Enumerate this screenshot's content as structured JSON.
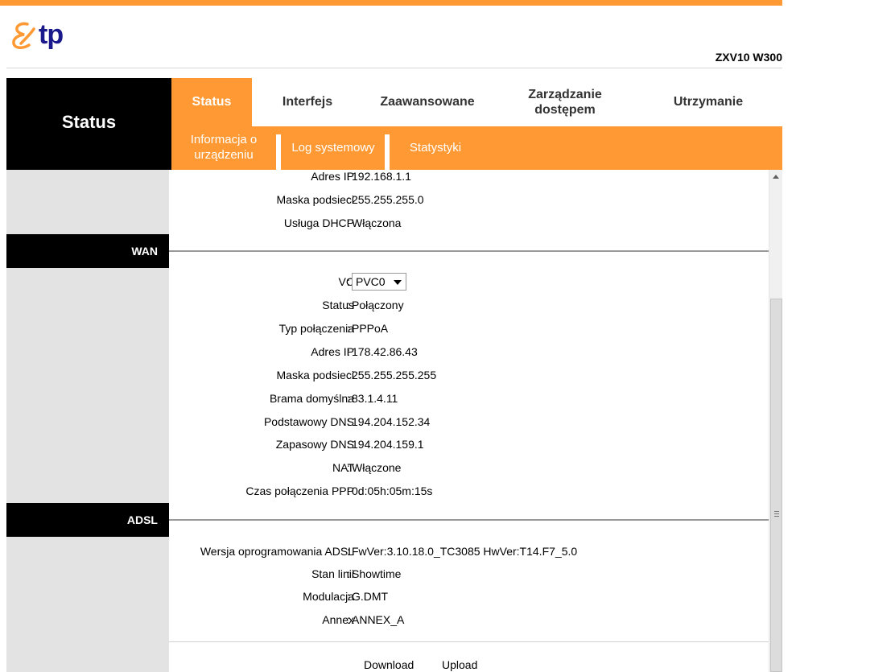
{
  "brand": {
    "logo_text": "tp",
    "model": "ZXV10 W300"
  },
  "colors": {
    "accent": "#ff9933",
    "section": "#000000",
    "left_panel": "#e3e3e3"
  },
  "left_title": "Status",
  "menu": {
    "status": "Status",
    "interfejs": "Interfejs",
    "zaawansowane": "Zaawansowane",
    "zarzadzanie": "Zarządzanie dostępem",
    "utrzymanie": "Utrzymanie"
  },
  "submenu": {
    "informacja": "Informacja o urządzeniu",
    "log": "Log systemowy",
    "statystyki": "Statystyki"
  },
  "lan": {
    "ip_label": "Adres IP",
    "ip_value": "192.168.1.1",
    "mask_label": "Maska podsieci",
    "mask_value": "255.255.255.0",
    "dhcp_label": "Usługa DHCP",
    "dhcp_value": "Włączona"
  },
  "wan": {
    "title": "WAN",
    "vc_label": "VC",
    "vc_selected": "PVC0",
    "status_label": "Status",
    "status_value": "Połączony",
    "type_label": "Typ połączenia",
    "type_value": "PPPoA",
    "ip_label": "Adres IP",
    "ip_value": "178.42.86.43",
    "mask_label": "Maska podsieci",
    "mask_value": "255.255.255.255",
    "gateway_label": "Brama domyślna",
    "gateway_value": "83.1.4.11",
    "dns1_label": "Podstawowy DNS",
    "dns1_value": "194.204.152.34",
    "dns2_label": "Zapasowy DNS",
    "dns2_value": "194.204.159.1",
    "nat_label": "NAT",
    "nat_value": "Włączone",
    "ppp_time_label": "Czas połączenia PPP",
    "ppp_time_value": "0d:05h:05m:15s"
  },
  "adsl": {
    "title": "ADSL",
    "fw_label": "Wersja oprogramowania ADSL",
    "fw_value": "FwVer:3.10.18.0_TC3085 HwVer:T14.F7_5.0",
    "line_label": "Stan linii",
    "line_value": "Showtime",
    "mod_label": "Modulacja",
    "mod_value": "G.DMT",
    "annex_label": "Annex",
    "annex_value": "ANNEX_A",
    "download_label": "Download",
    "upload_label": "Upload"
  }
}
